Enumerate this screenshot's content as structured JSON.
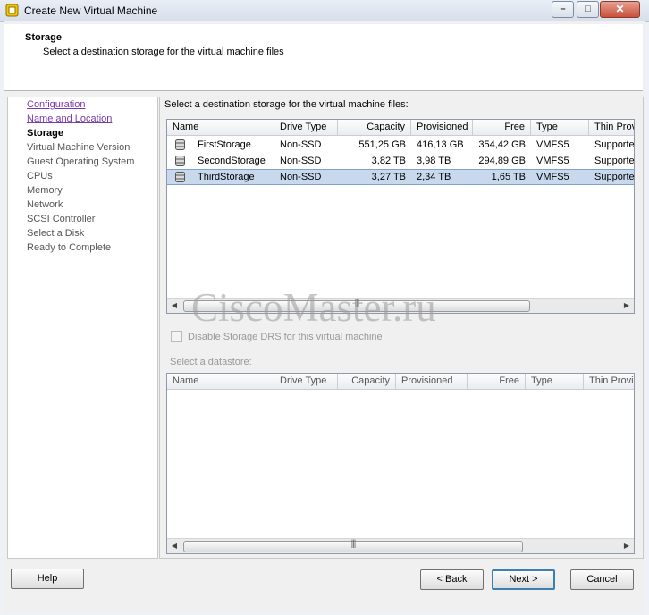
{
  "window": {
    "title": "Create New Virtual Machine"
  },
  "header": {
    "title": "Storage",
    "subtitle": "Select a destination storage for the virtual machine files"
  },
  "nav": {
    "items": [
      {
        "label": "Configuration",
        "state": "link"
      },
      {
        "label": "Name and Location",
        "state": "link"
      },
      {
        "label": "Storage",
        "state": "current"
      },
      {
        "label": "Virtual Machine Version",
        "state": "pending"
      },
      {
        "label": "Guest Operating System",
        "state": "pending"
      },
      {
        "label": "CPUs",
        "state": "pending"
      },
      {
        "label": "Memory",
        "state": "pending"
      },
      {
        "label": "Network",
        "state": "pending"
      },
      {
        "label": "SCSI Controller",
        "state": "pending"
      },
      {
        "label": "Select a Disk",
        "state": "pending"
      },
      {
        "label": "Ready to Complete",
        "state": "pending"
      }
    ]
  },
  "main": {
    "label": "Select a destination storage for the virtual machine files:",
    "storage_table": {
      "columns": [
        "Name",
        "Drive Type",
        "Capacity",
        "Provisioned",
        "Free",
        "Type",
        "Thin Prov"
      ],
      "rows": [
        {
          "name": "FirstStorage",
          "drive_type": "Non-SSD",
          "capacity": "551,25 GB",
          "provisioned": "416,13 GB",
          "free": "354,42 GB",
          "type": "VMFS5",
          "thin": "Supporte",
          "selected": false
        },
        {
          "name": "SecondStorage",
          "drive_type": "Non-SSD",
          "capacity": "3,82 TB",
          "provisioned": "3,98 TB",
          "free": "294,89 GB",
          "type": "VMFS5",
          "thin": "Supporte",
          "selected": false
        },
        {
          "name": "ThirdStorage",
          "drive_type": "Non-SSD",
          "capacity": "3,27 TB",
          "provisioned": "2,34 TB",
          "free": "1,65 TB",
          "type": "VMFS5",
          "thin": "Supporte",
          "selected": true
        }
      ]
    },
    "drs_checkbox": {
      "label": "Disable Storage DRS for this virtual machine",
      "checked": false,
      "enabled": false
    },
    "datastore_label": "Select a datastore:",
    "datastore_table": {
      "columns": [
        "Name",
        "Drive Type",
        "Capacity",
        "Provisioned",
        "Free",
        "Type",
        "Thin Provi"
      ],
      "rows": []
    }
  },
  "watermark": "CiscoMaster.ru",
  "buttons": {
    "help": "Help",
    "back": "< Back",
    "next": "Next >",
    "cancel": "Cancel"
  },
  "colors": {
    "selection": "#c8d9ee",
    "visited_link": "#7a3aa8",
    "default_button_border": "#3c7fb1"
  }
}
